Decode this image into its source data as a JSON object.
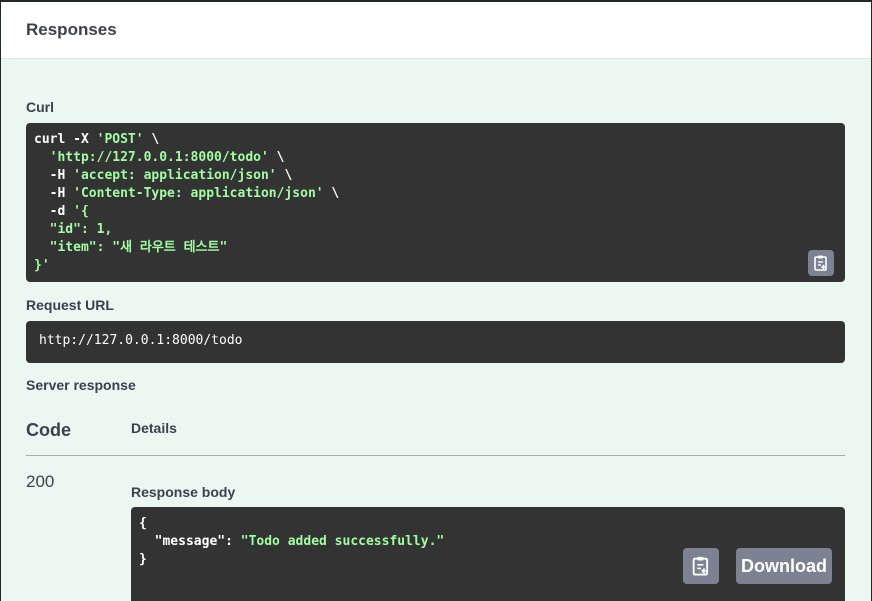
{
  "header": {
    "title": "Responses"
  },
  "curl": {
    "label": "Curl",
    "lines": [
      {
        "plain": "curl -X ",
        "str": "'POST'",
        "tail": " \\"
      },
      {
        "plain": "  ",
        "str": "'http://127.0.0.1:8000/todo'",
        "tail": " \\"
      },
      {
        "plain": "  -H ",
        "str": "'accept: application/json'",
        "tail": " \\"
      },
      {
        "plain": "  -H ",
        "str": "'Content-Type: application/json'",
        "tail": " \\"
      },
      {
        "plain": "  -d ",
        "str": "'{",
        "tail": ""
      },
      {
        "plain": "",
        "str": "  \"id\": 1,",
        "tail": ""
      },
      {
        "plain": "",
        "str": "  \"item\": \"새 라우트 테스트\"",
        "tail": ""
      },
      {
        "plain": "",
        "str": "}'",
        "tail": ""
      }
    ]
  },
  "request_url": {
    "label": "Request URL",
    "value": "http://127.0.0.1:8000/todo"
  },
  "server_response": {
    "label": "Server response",
    "col_code": "Code",
    "col_details": "Details",
    "code": "200",
    "body_label": "Response body",
    "body_lines": [
      {
        "plain": "{",
        "str": ""
      },
      {
        "plain": "  \"message\": ",
        "str": "\"Todo added successfully.\""
      },
      {
        "plain": "}",
        "str": ""
      }
    ],
    "download_label": "Download"
  },
  "icons": {
    "copy": "clipboard-copy-icon"
  },
  "colors": {
    "code_bg": "#333333",
    "string": "#a2fca2",
    "panel_bg": "#ebf8f1",
    "button": "#7d8293"
  }
}
